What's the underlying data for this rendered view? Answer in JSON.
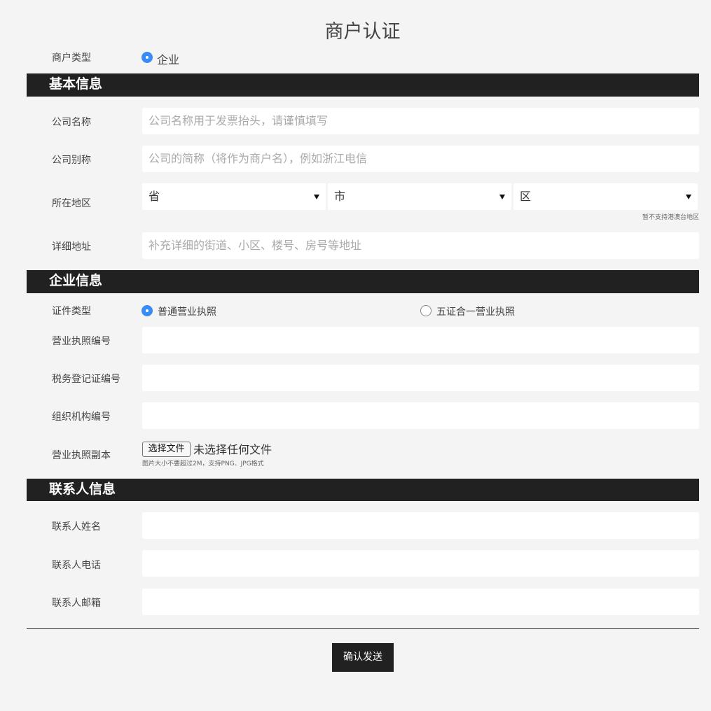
{
  "page": {
    "title": "商户认证"
  },
  "merchant_type": {
    "label": "商户类型",
    "option": "企业"
  },
  "sections": {
    "basic": "基本信息",
    "enterprise": "企业信息",
    "contact": "联系人信息"
  },
  "basic": {
    "company_name": {
      "label": "公司名称",
      "placeholder": "公司名称用于发票抬头，请谨慎填写"
    },
    "company_alias": {
      "label": "公司别称",
      "placeholder": "公司的简称（将作为商户名），例如浙江电信"
    },
    "region": {
      "label": "所在地区",
      "province": "省",
      "city": "市",
      "district": "区",
      "hint": "暂不支持港澳台地区"
    },
    "address": {
      "label": "详细地址",
      "placeholder": "补充详细的街道、小区、楼号、房号等地址"
    }
  },
  "enterprise": {
    "cert_type": {
      "label": "证件类型",
      "option_normal": "普通营业执照",
      "option_five_in_one": "五证合一营业执照"
    },
    "license_no": {
      "label": "营业执照编号",
      "value": ""
    },
    "tax_no": {
      "label": "税务登记证编号",
      "value": ""
    },
    "org_no": {
      "label": "组织机构编号",
      "value": ""
    },
    "license_copy": {
      "label": "营业执照副本",
      "button": "选择文件",
      "status": "未选择任何文件",
      "hint": "图片大小不要超过2M，支持PNG、JPG格式"
    }
  },
  "contact": {
    "name": {
      "label": "联系人姓名",
      "value": ""
    },
    "phone": {
      "label": "联系人电话",
      "value": ""
    },
    "email": {
      "label": "联系人邮箱",
      "value": ""
    }
  },
  "submit": {
    "label": "确认发送"
  },
  "colors": {
    "header_bg": "#212121",
    "radio_active": "#3b8bf5",
    "page_bg": "#f4f4f4"
  }
}
